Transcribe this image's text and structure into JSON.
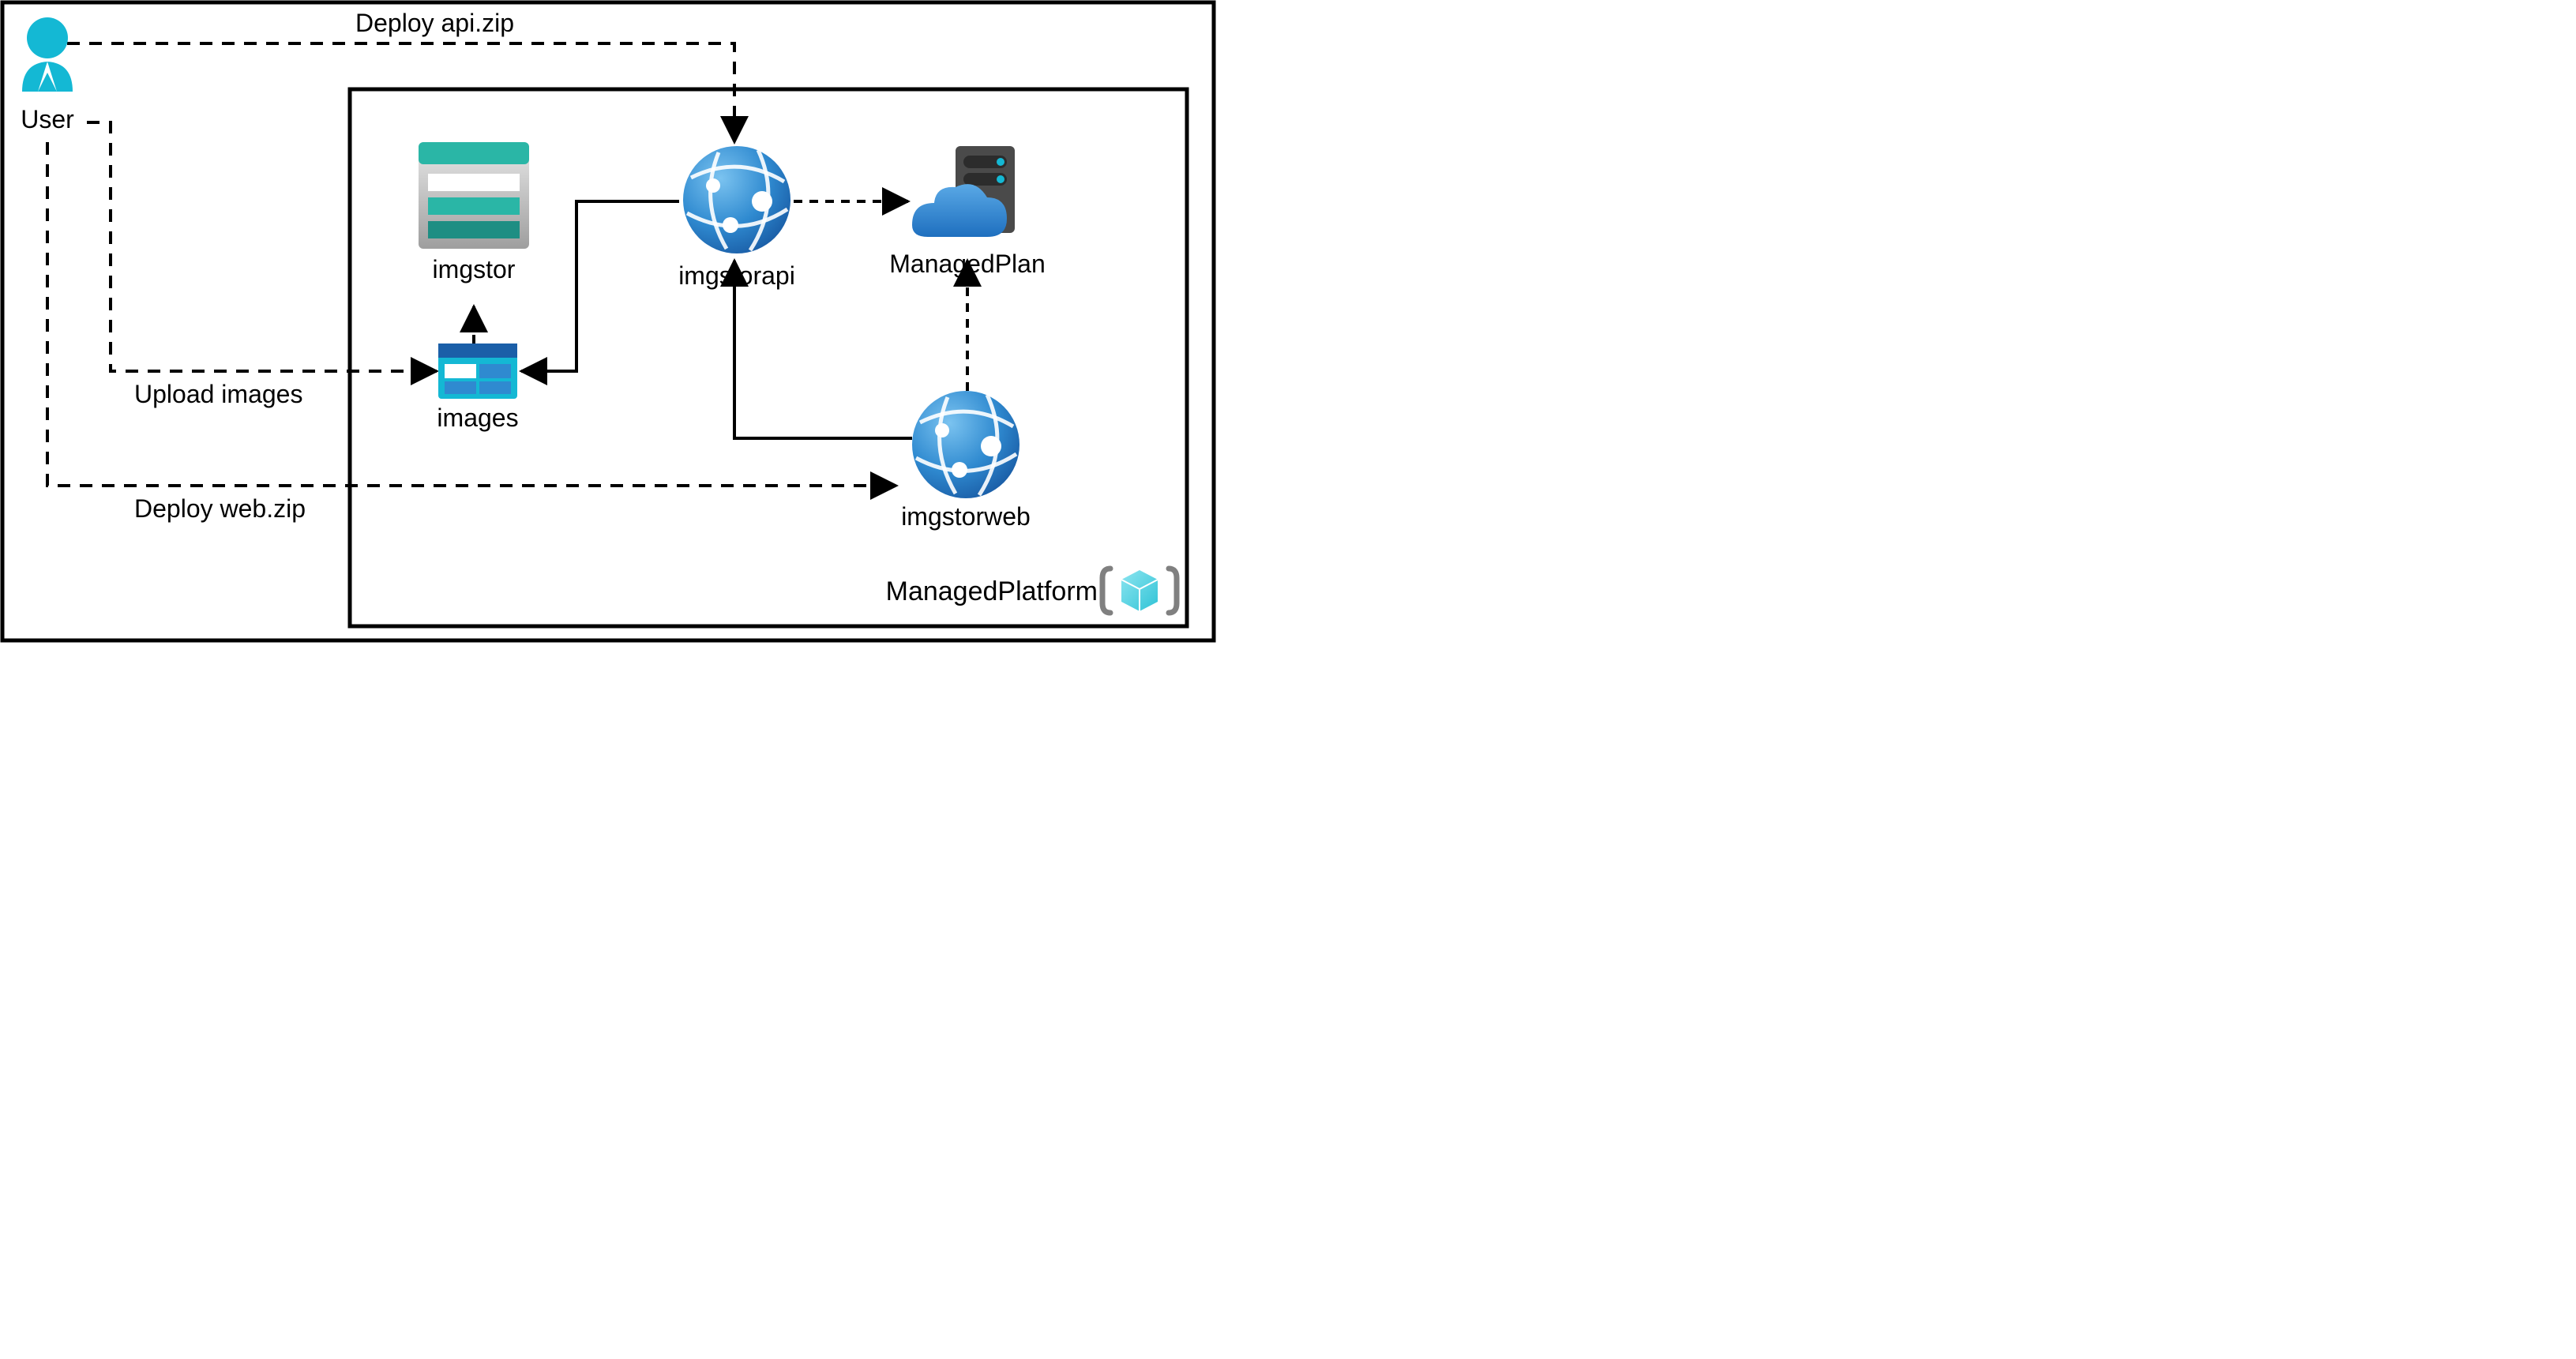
{
  "nodes": {
    "user": "User",
    "imgstor": "imgstor",
    "images": "images",
    "imgstorapi": "imgstorapi",
    "managedPlan": "ManagedPlan",
    "imgstorweb": "imgstorweb",
    "managedPlatform": "ManagedPlatform"
  },
  "edges": {
    "deployApi": "Deploy api.zip",
    "uploadImages": "Upload images",
    "deployWeb": "Deploy web.zip"
  },
  "connections": [
    {
      "from": "User",
      "to": "imgstorapi",
      "label": "Deploy api.zip",
      "style": "dashed"
    },
    {
      "from": "User",
      "to": "images",
      "label": "Upload images",
      "style": "dashed"
    },
    {
      "from": "User",
      "to": "imgstorweb",
      "label": "Deploy web.zip",
      "style": "dashed"
    },
    {
      "from": "images",
      "to": "imgstor",
      "style": "dashed"
    },
    {
      "from": "imgstorapi",
      "to": "images",
      "style": "solid",
      "bidirectional": false
    },
    {
      "from": "images",
      "to": "imgstorapi",
      "style": "solid"
    },
    {
      "from": "imgstorapi",
      "to": "ManagedPlan",
      "style": "dashed"
    },
    {
      "from": "imgstorweb",
      "to": "imgstorapi",
      "style": "solid"
    },
    {
      "from": "imgstorweb",
      "to": "ManagedPlan",
      "style": "dashed"
    }
  ],
  "colors": {
    "azureBlue": "#2F8AD0",
    "azureDarkBlue": "#1B5FA8",
    "teal": "#2AB6A6",
    "tealDark": "#1E8E83",
    "cyan": "#14B8D4",
    "gray": "#B0B0B0",
    "darkGray": "#4A4A4A",
    "white": "#FFFFFF"
  }
}
